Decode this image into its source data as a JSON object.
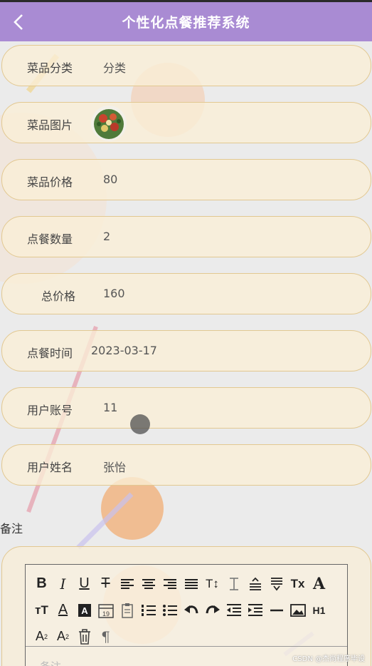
{
  "header": {
    "title": "个性化点餐推荐系统",
    "back_icon": "chevron-left-icon"
  },
  "fields": [
    {
      "label": "菜品分类",
      "value": "分类"
    },
    {
      "label": "菜品图片",
      "value": "",
      "image": "food-thumbnail"
    },
    {
      "label": "菜品价格",
      "value": "80"
    },
    {
      "label": "点餐数量",
      "value": "2"
    },
    {
      "label": "总价格",
      "value": "160"
    },
    {
      "label": "点餐时间",
      "value": "2023-03-17"
    },
    {
      "label": "用户账号",
      "value": "11"
    },
    {
      "label": "用户姓名",
      "value": "张怡"
    }
  ],
  "remark": {
    "label": "备注",
    "placeholder": "备注"
  },
  "editor_toolbar": [
    [
      "bold-icon",
      "italic-icon",
      "underline-icon",
      "strikethrough-icon",
      "align-left-icon",
      "align-center-icon",
      "align-right-icon",
      "align-justify-icon",
      "line-height-icon",
      "text-height-icon",
      "paragraph-spacing-icon",
      "indent-down-icon",
      "clear-format-icon",
      "font-color-icon"
    ],
    [
      "font-size-icon",
      "underline-color-icon",
      "background-color-icon",
      "date-icon",
      "clipboard-icon",
      "ordered-list-icon",
      "bullet-list-icon",
      "undo-icon",
      "redo-icon",
      "outdent-icon",
      "indent-icon",
      "horizontal-rule-icon",
      "image-icon",
      "heading-icon"
    ],
    [
      "subscript-icon",
      "superscript-icon",
      "delete-icon",
      "paragraph-mark-icon"
    ]
  ],
  "watermark": "CSDN @杰尚程序毕设",
  "colors": {
    "header": "#a98bd3",
    "row_border": "#e2c891",
    "row_fill": "#faeed6"
  }
}
